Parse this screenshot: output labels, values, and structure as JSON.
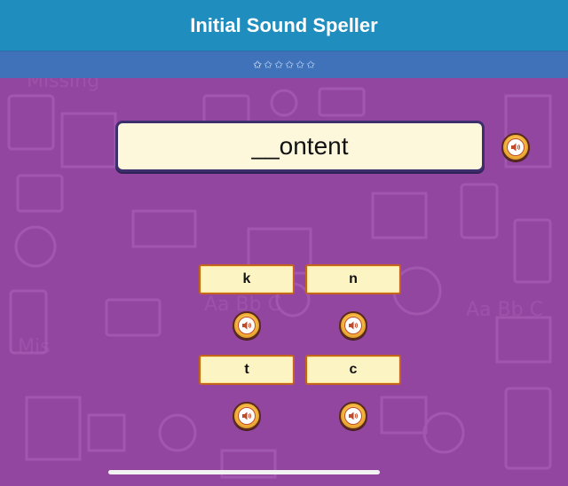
{
  "header": {
    "title": "Initial Sound Speller"
  },
  "progress": {
    "total_stars": 6,
    "filled_stars": 1
  },
  "puzzle": {
    "word_display": "__ontent"
  },
  "choices": [
    {
      "letter": "k"
    },
    {
      "letter": "n"
    },
    {
      "letter": "t"
    },
    {
      "letter": "c"
    }
  ],
  "icons": {
    "sound": "speaker-icon",
    "star": "star-icon"
  },
  "colors": {
    "title_bar": "#1f8dbd",
    "progress_bar": "#3f72b8",
    "play_area": "#93469f",
    "word_box": "#fdf8dc",
    "choice_box": "#fdf4c4",
    "choice_border": "#c2641f"
  }
}
